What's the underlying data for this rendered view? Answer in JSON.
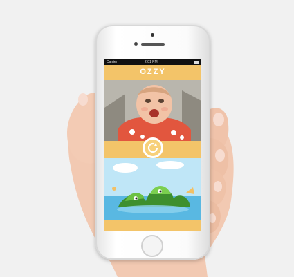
{
  "status_bar": {
    "carrier": "Carrier",
    "time": "2:01 PM"
  },
  "app": {
    "title": "OZZY",
    "brand_color": "#f3c469"
  },
  "content": {
    "top_photo": "baby-photo",
    "bottom_image": "cartoon-island-illustration"
  },
  "icons": {
    "refresh": "refresh-icon",
    "home": "home-button"
  }
}
